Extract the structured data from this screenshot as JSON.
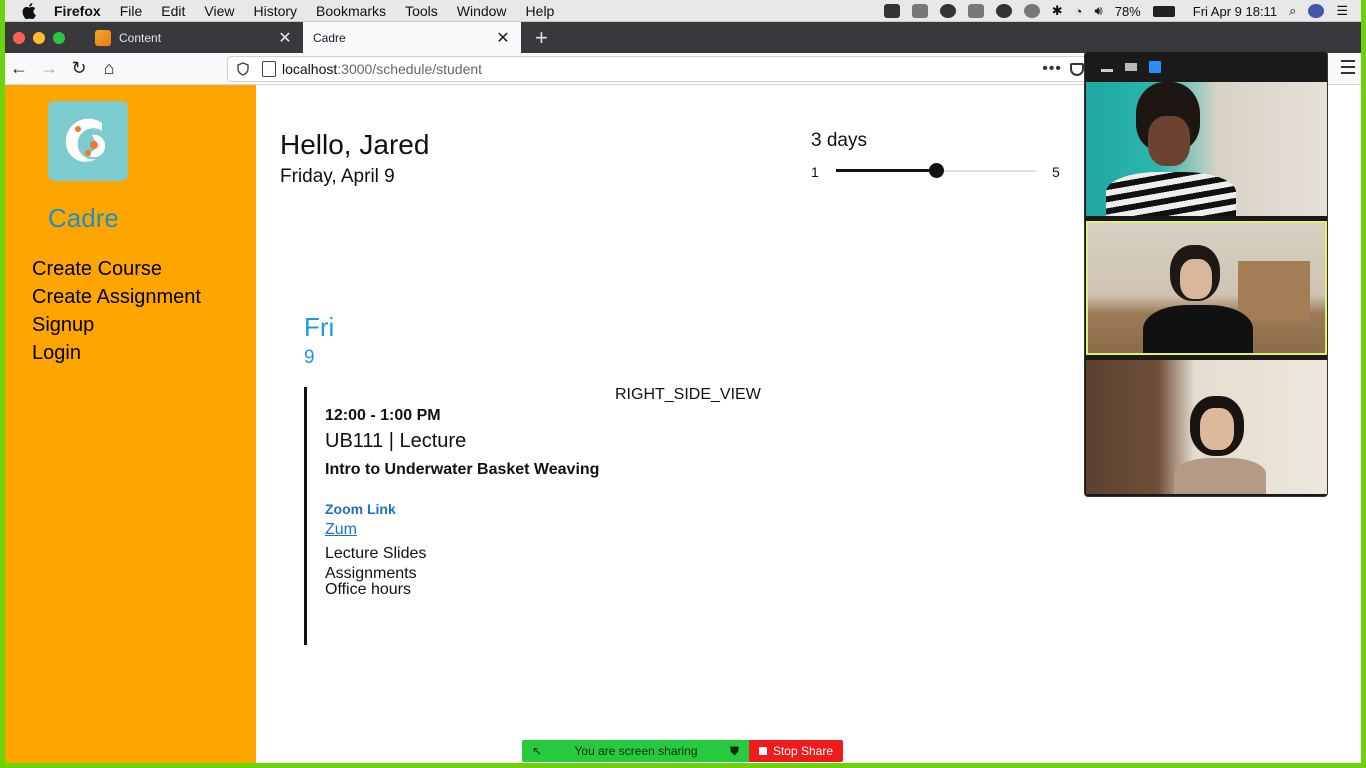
{
  "menubar": {
    "app": "Firefox",
    "items": [
      "File",
      "Edit",
      "View",
      "History",
      "Bookmarks",
      "Tools",
      "Window",
      "Help"
    ],
    "battery": "78%",
    "clock": "Fri Apr 9  18:11"
  },
  "tabs": [
    {
      "label": "Content",
      "active": false
    },
    {
      "label": "Cadre",
      "active": true
    }
  ],
  "url": {
    "host": "localhost",
    "path": ":3000/schedule/student"
  },
  "sidebar": {
    "brand": "Cadre",
    "items": [
      "Create Course",
      "Create Assignment",
      "Signup",
      "Login"
    ]
  },
  "header": {
    "greeting": "Hello, Jared",
    "date": "Friday, April 9"
  },
  "days_slider": {
    "label": "3 days",
    "min": "1",
    "max": "5",
    "value": 3
  },
  "schedule": {
    "day_name": "Fri",
    "day_number": "9",
    "right_view_label": "RIGHT_SIDE_VIEW",
    "event": {
      "time": "12:00 - 1:00 PM",
      "title": "UB111 | Lecture",
      "description": "Intro to Underwater Basket Weaving",
      "zoom_heading": "Zoom Link",
      "zoom_link": "Zum",
      "slides": "Lecture Slides",
      "assignments": "Assignments",
      "office_hours": "Office hours"
    }
  },
  "screen_share": {
    "message": "You are screen sharing",
    "stop_label": "Stop Share"
  },
  "colors": {
    "sidebar": "#ffa500",
    "brand": "#1f8fc4",
    "accent_blue": "#1a9be0",
    "share_green": "#27c93f",
    "share_red": "#ee1c1c"
  }
}
